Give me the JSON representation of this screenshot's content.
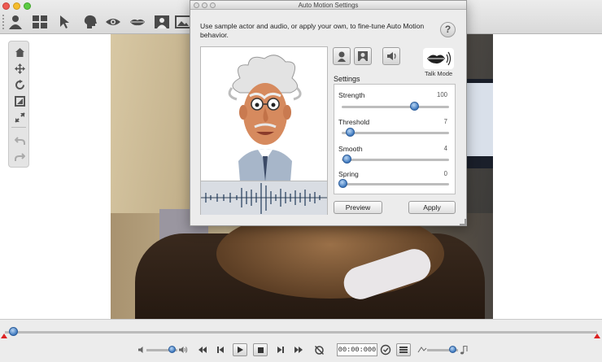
{
  "dialog": {
    "title": "Auto Motion Settings",
    "description": "Use sample actor and audio, or apply your own, to fine-tune Auto Motion behavior.",
    "help_label": "?",
    "talk_mode_label": "Talk Mode",
    "settings_label": "Settings",
    "settings": [
      {
        "name": "Strength",
        "value": "100",
        "level": 0.7
      },
      {
        "name": "Threshold",
        "value": "7",
        "level": 0.07
      },
      {
        "name": "Smooth",
        "value": "4",
        "level": 0.04
      },
      {
        "name": "Spring",
        "value": "0",
        "level": 0.0
      }
    ],
    "preview_button": "Preview",
    "apply_button": "Apply"
  },
  "toolbar": {
    "icons": [
      "actor-icon",
      "scene-grid-icon",
      "pointer-icon",
      "head-icon",
      "eye-icon",
      "lips-icon",
      "portrait-icon",
      "image-icon"
    ]
  },
  "tools": {
    "icons": [
      "home-icon",
      "move-icon",
      "rotate-icon",
      "fit-icon",
      "expand-icon",
      "undo-icon",
      "redo-icon"
    ]
  },
  "playback": {
    "time": "00:00:000"
  },
  "colors": {
    "accent": "#3f79bf",
    "marker": "#dd2222"
  }
}
